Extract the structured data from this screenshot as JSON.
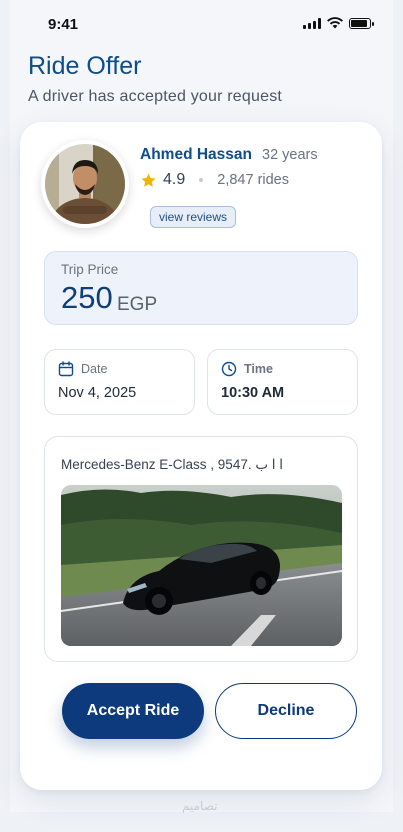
{
  "status_bar": {
    "time": "9:41"
  },
  "header": {
    "title": "Ride Offer",
    "subtitle": "A driver has accepted your request"
  },
  "driver": {
    "name": "Ahmed Hassan",
    "age": "32 years",
    "rating": "4.9",
    "rides": "2,847 rides",
    "reviews_label": "view reviews"
  },
  "price": {
    "label": "Trip Price",
    "amount": "250",
    "currency": "EGP"
  },
  "date": {
    "label": "Date",
    "value": "Nov 4, 2025"
  },
  "time": {
    "label": "Time",
    "value": "10:30 AM"
  },
  "car": {
    "description": "Mercedes-Benz E-Class , 9547. ا ا ب"
  },
  "actions": {
    "accept_label": "Accept Ride",
    "decline_label": "Decline"
  },
  "watermark": "تصاميم",
  "colors": {
    "primary": "#0d3a7d",
    "title": "#0e4d8a",
    "star": "#f5b301"
  }
}
